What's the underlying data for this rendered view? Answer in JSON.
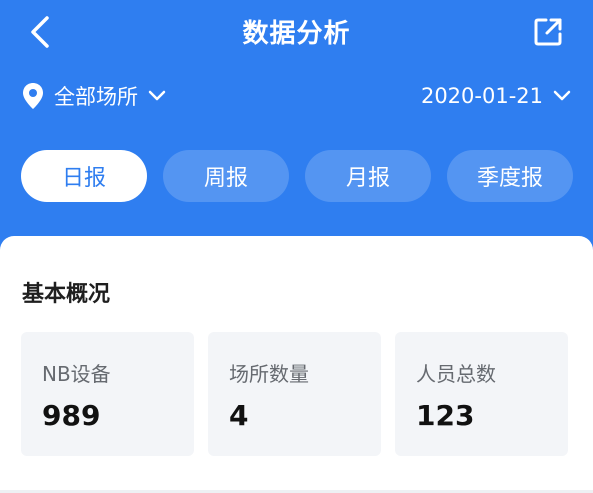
{
  "header": {
    "title": "数据分析",
    "back_icon": "chevron-left-icon",
    "share_icon": "external-link-icon"
  },
  "filters": {
    "venue": "全部场所",
    "date": "2020-01-21"
  },
  "tabs": [
    {
      "label": "日报",
      "active": true
    },
    {
      "label": "周报",
      "active": false
    },
    {
      "label": "月报",
      "active": false
    },
    {
      "label": "季度报",
      "active": false
    }
  ],
  "overview": {
    "title": "基本概况",
    "stats": [
      {
        "label": "NB设备",
        "value": "989"
      },
      {
        "label": "场所数量",
        "value": "4"
      },
      {
        "label": "人员总数",
        "value": "123"
      }
    ]
  },
  "colors": {
    "brand": "#2f7ef0",
    "card_bg": "#f3f5f8"
  }
}
